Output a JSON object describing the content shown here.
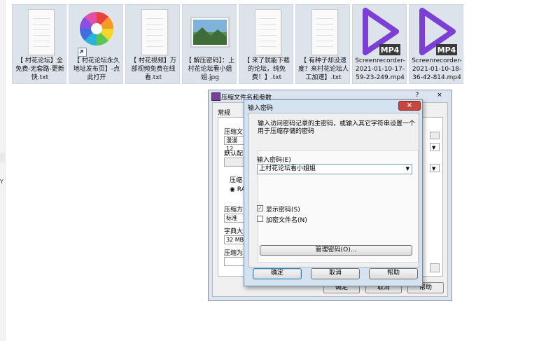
{
  "files": [
    {
      "name": "【 村花论坛】全免费-无套路-更新快.txt",
      "icon": "text-file-icon"
    },
    {
      "name": "【 村花论坛永久地址发布页】-点此打开",
      "icon": "colorful-pinwheel-shortcut-icon"
    },
    {
      "name": "【 村花视频】万部视频免费在线看.txt",
      "icon": "text-file-icon"
    },
    {
      "name": "【 解压密码】：上村花论坛看小姐姐.jpg",
      "icon": "image-file-icon"
    },
    {
      "name": "【 来了就能下载的论坛，纯免费！】.txt",
      "icon": "text-file-icon"
    },
    {
      "name": "【 有种子却没速度？来村花论坛人工加速】.txt",
      "icon": "text-file-icon"
    },
    {
      "name": "Screenrecorder-2021-01-10-17-59-23-249.mp4",
      "icon": "mp4-video-icon",
      "badge": "MP4"
    },
    {
      "name": "Screenrecorder-2021-01-10-18-36-42-814.mp4",
      "icon": "mp4-video-icon",
      "badge": "MP4"
    }
  ],
  "left_strip": {
    "mark": "Y"
  },
  "back_dialog": {
    "title": "压缩文件名和参数",
    "help_label": "?",
    "close_label": "×",
    "tab_general": "常规",
    "archive_name_label": "压缩文",
    "archive_name_value": "漫漫12",
    "default_profile_label": "默认配",
    "compression_format_label": "压缩",
    "format_rar_label": "RA",
    "compression_method_label": "压缩方",
    "compression_method_value": "标准",
    "dictionary_label": "字典大",
    "dictionary_value": "32 MB",
    "split_label": "压缩为",
    "ok_label": "确定",
    "cancel_label": "取消",
    "help_button_label": "帮助"
  },
  "password_dialog": {
    "title": "输入密码",
    "close_label": "×",
    "instruction": "输入访问密码记录的主密码，或输入其它字符串设置一个用于压缩存储的密码",
    "password_label": "输入密码(E)",
    "password_value": "上村花论坛看小姐姐",
    "show_password_label": "显示密码(S)",
    "show_password_checked": true,
    "encrypt_names_label": "加密文件名(N)",
    "encrypt_names_checked": false,
    "manage_button": "管理密码(O)...",
    "ok_button": "确定",
    "cancel_button": "取消",
    "help_button": "帮助"
  }
}
